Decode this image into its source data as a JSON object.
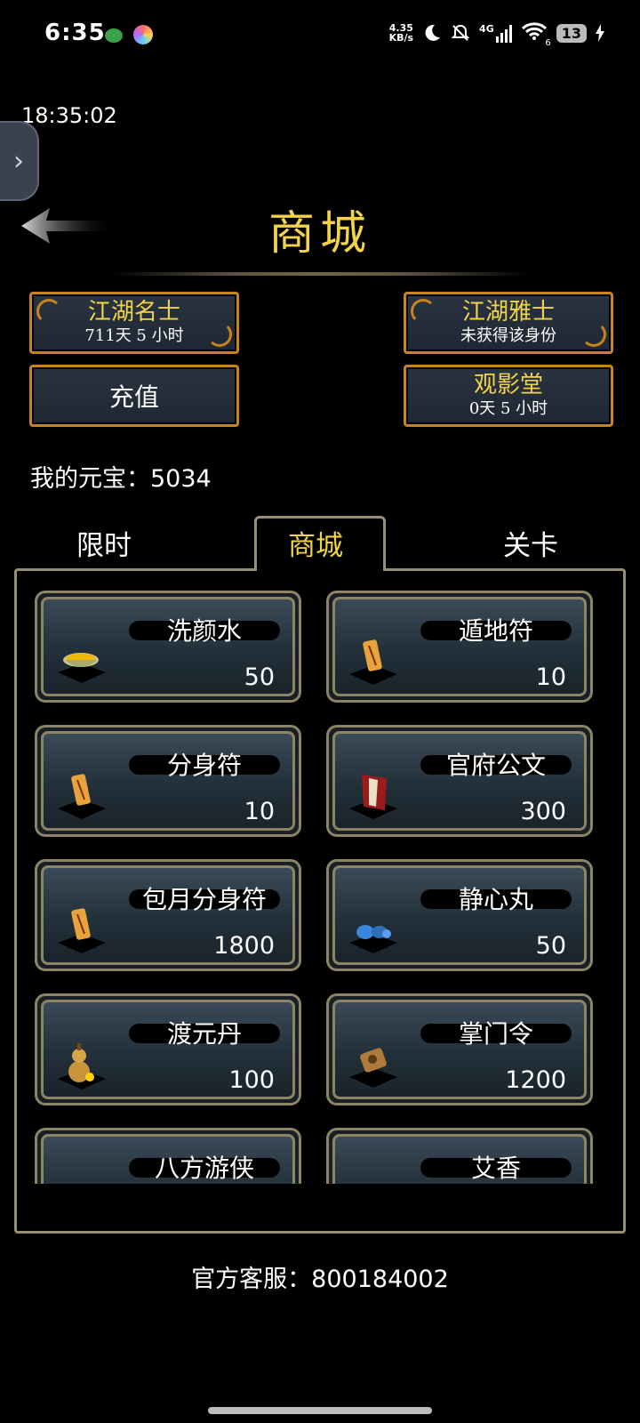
{
  "status_bar": {
    "time": "6:35",
    "net_speed_value": "4.35",
    "net_speed_unit": "KB/s",
    "network": "4G",
    "wifi_label": "6",
    "battery": "13"
  },
  "clock": "18:35:02",
  "header": {
    "title": "商城"
  },
  "identity": {
    "left": {
      "title": "江湖名士",
      "sub": "711天 5 小时"
    },
    "right": {
      "title": "江湖雅士",
      "sub": "未获得该身份"
    }
  },
  "actions": {
    "recharge": "充值",
    "theater": {
      "title": "观影堂",
      "sub": "0天 5 小时"
    }
  },
  "balance": {
    "label": "我的元宝：",
    "value": "5034"
  },
  "tabs": [
    {
      "label": "限时",
      "active": false
    },
    {
      "label": "商城",
      "active": true
    },
    {
      "label": "关卡",
      "active": false
    }
  ],
  "items": [
    {
      "name": "洗颜水",
      "price": "50",
      "icon": "bowl-icon"
    },
    {
      "name": "遁地符",
      "price": "10",
      "icon": "talisman-icon"
    },
    {
      "name": "分身符",
      "price": "10",
      "icon": "talisman-icon"
    },
    {
      "name": "官府公文",
      "price": "300",
      "icon": "scroll-icon"
    },
    {
      "name": "包月分身符",
      "price": "1800",
      "icon": "talisman-icon"
    },
    {
      "name": "静心丸",
      "price": "50",
      "icon": "pill-icon"
    },
    {
      "name": "渡元丹",
      "price": "100",
      "icon": "gourd-icon"
    },
    {
      "name": "掌门令",
      "price": "1200",
      "icon": "token-icon"
    },
    {
      "name": "八方游侠",
      "price": "",
      "icon": "hat-icon"
    },
    {
      "name": "艾香",
      "price": "",
      "icon": "incense-icon"
    }
  ],
  "footer": {
    "service": "官方客服：800184002"
  },
  "colors": {
    "accent_gold": "#f2d44a",
    "button_border": "#c8831e",
    "frame": "#958f7a"
  }
}
